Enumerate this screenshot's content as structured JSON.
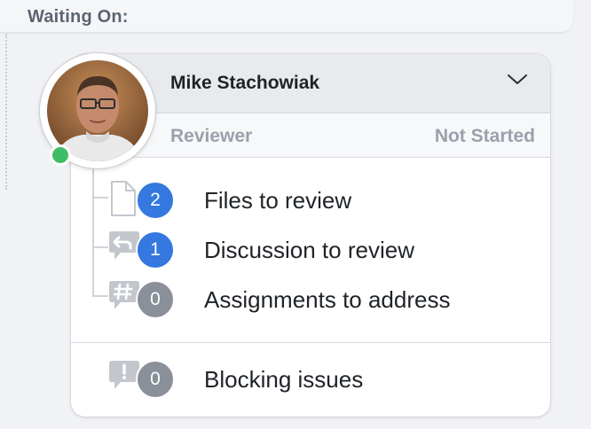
{
  "section": {
    "title": "Waiting On:"
  },
  "reviewer": {
    "name": "Mike Stachowiak",
    "role": "Reviewer",
    "status": "Not Started",
    "presence": "online",
    "presence_color": "#3fbd66"
  },
  "items": [
    {
      "icon": "file-icon",
      "count": "2",
      "label": "Files to review",
      "badge_color": "#3478e0"
    },
    {
      "icon": "reply-comment-icon",
      "count": "1",
      "label": "Discussion to review",
      "badge_color": "#3478e0"
    },
    {
      "icon": "hash-comment-icon",
      "count": "0",
      "label": "Assignments to address",
      "badge_color": "#8a9099"
    }
  ],
  "blocking": {
    "icon": "exclamation-comment-icon",
    "count": "0",
    "label": "Blocking issues",
    "badge_color": "#8a9099"
  }
}
